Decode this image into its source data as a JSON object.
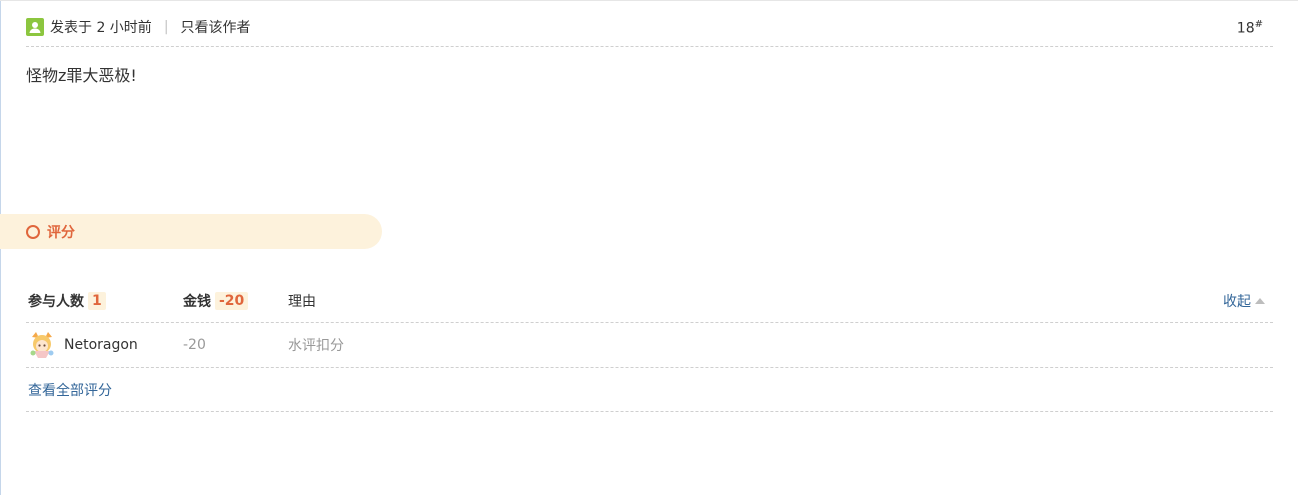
{
  "post": {
    "posted_time": "发表于 2 小时前",
    "separator": "|",
    "only_author_link": "只看该作者",
    "floor_number": "18",
    "floor_mark": "#",
    "body_text": "怪物z罪大恶极!"
  },
  "rating": {
    "section_title": "评分",
    "headers": {
      "participants_label": "参与人数",
      "participants_count": "1",
      "money_label": "金钱",
      "money_total": "-20",
      "reason_label": "理由",
      "collapse_label": "收起"
    },
    "entries": [
      {
        "username": "Netoragon",
        "money": "-20",
        "reason": "水评扣分"
      }
    ],
    "view_all_label": "查看全部评分"
  },
  "colors": {
    "accent": "#e0663c",
    "banner_bg": "#fdf2dc",
    "link": "#336699",
    "avatar_green": "#8cc63f"
  }
}
